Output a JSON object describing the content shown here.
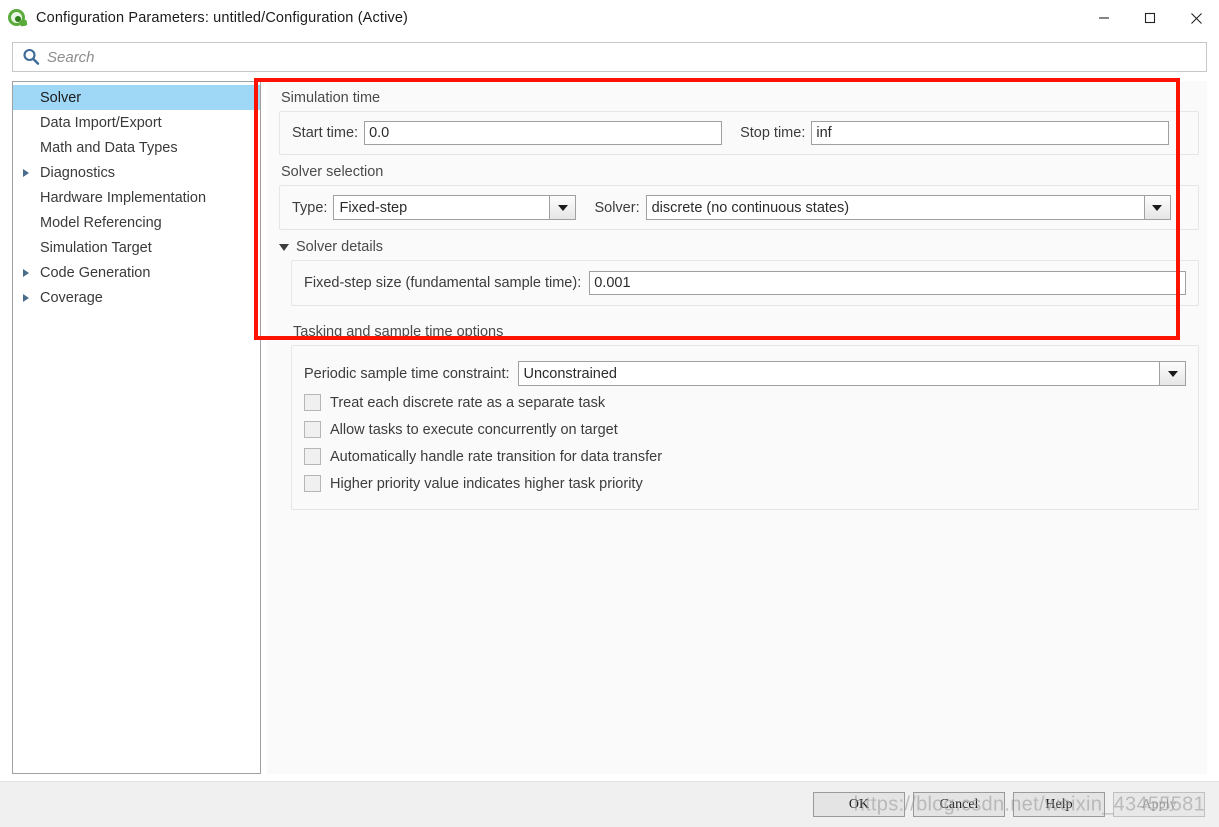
{
  "window": {
    "title": "Configuration Parameters: untitled/Configuration (Active)",
    "app_icon": "simulink-icon",
    "minimize_label": "—",
    "maximize_label": "□",
    "close_label": "✕"
  },
  "search": {
    "placeholder": "Search",
    "value": "",
    "icon": "search-icon"
  },
  "sidebar": {
    "items": [
      {
        "label": "Solver",
        "expandable": false,
        "selected": true
      },
      {
        "label": "Data Import/Export",
        "expandable": false,
        "selected": false
      },
      {
        "label": "Math and Data Types",
        "expandable": false,
        "selected": false
      },
      {
        "label": "Diagnostics",
        "expandable": true,
        "selected": false
      },
      {
        "label": "Hardware Implementation",
        "expandable": false,
        "selected": false
      },
      {
        "label": "Model Referencing",
        "expandable": false,
        "selected": false
      },
      {
        "label": "Simulation Target",
        "expandable": false,
        "selected": false
      },
      {
        "label": "Code Generation",
        "expandable": true,
        "selected": false
      },
      {
        "label": "Coverage",
        "expandable": true,
        "selected": false
      }
    ]
  },
  "main": {
    "simulation_time": {
      "title": "Simulation time",
      "start_time_label": "Start time:",
      "start_time_value": "0.0",
      "stop_time_label": "Stop time:",
      "stop_time_value": "inf"
    },
    "solver_selection": {
      "title": "Solver selection",
      "type_label": "Type:",
      "type_value": "Fixed-step",
      "solver_label": "Solver:",
      "solver_value": "discrete (no continuous states)"
    },
    "solver_details": {
      "title": "Solver details",
      "expanded": true,
      "fixed_step_label": "Fixed-step size (fundamental sample time):",
      "fixed_step_value": "0.001"
    },
    "tasking": {
      "title": "Tasking and sample time options",
      "constraint_label": "Periodic sample time constraint:",
      "constraint_value": "Unconstrained",
      "checkboxes": [
        {
          "label": "Treat each discrete rate as a separate task",
          "checked": false
        },
        {
          "label": "Allow tasks to execute concurrently on target",
          "checked": false
        },
        {
          "label": "Automatically handle rate transition for data transfer",
          "checked": false
        },
        {
          "label": "Higher priority value indicates higher task priority",
          "checked": false
        }
      ]
    }
  },
  "annotation": {
    "highlight_color": "#fb1200"
  },
  "footer": {
    "ok_label": "OK",
    "cancel_label": "Cancel",
    "help_label": "Help",
    "apply_label": "Apply",
    "apply_disabled": true
  },
  "watermark": {
    "text": "https://blog.csdn.net/weixin_43455581"
  },
  "colors": {
    "selection": "#9fd8f7",
    "accent_icon": "#5aab3c",
    "search_icon": "#3d6b99"
  }
}
